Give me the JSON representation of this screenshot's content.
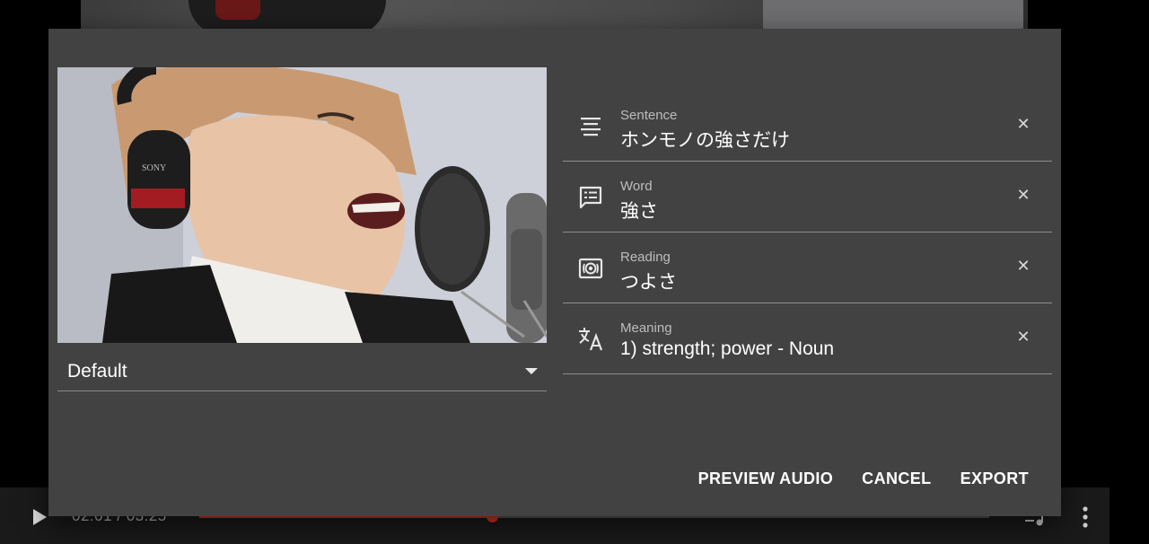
{
  "player": {
    "time_display": "02:01 / 03:25",
    "progress": 0.37,
    "accent_color": "#e0321f"
  },
  "dialog": {
    "thumbnail_icon": "video-frame-thumbnail",
    "track_select": {
      "value": "Default"
    },
    "fields": [
      {
        "label": "Sentence",
        "value": "ホンモノの強さだけ",
        "icon": "subject-icon"
      },
      {
        "label": "Word",
        "value": "強さ",
        "icon": "short-text-icon"
      },
      {
        "label": "Reading",
        "value": "つよさ",
        "icon": "speaker-notes-icon"
      },
      {
        "label": "Meaning",
        "value": "1)  strength;  power - Noun",
        "icon": "translate-icon"
      }
    ],
    "actions": {
      "preview_audio": "PREVIEW AUDIO",
      "cancel": "CANCEL",
      "export": "EXPORT"
    }
  }
}
